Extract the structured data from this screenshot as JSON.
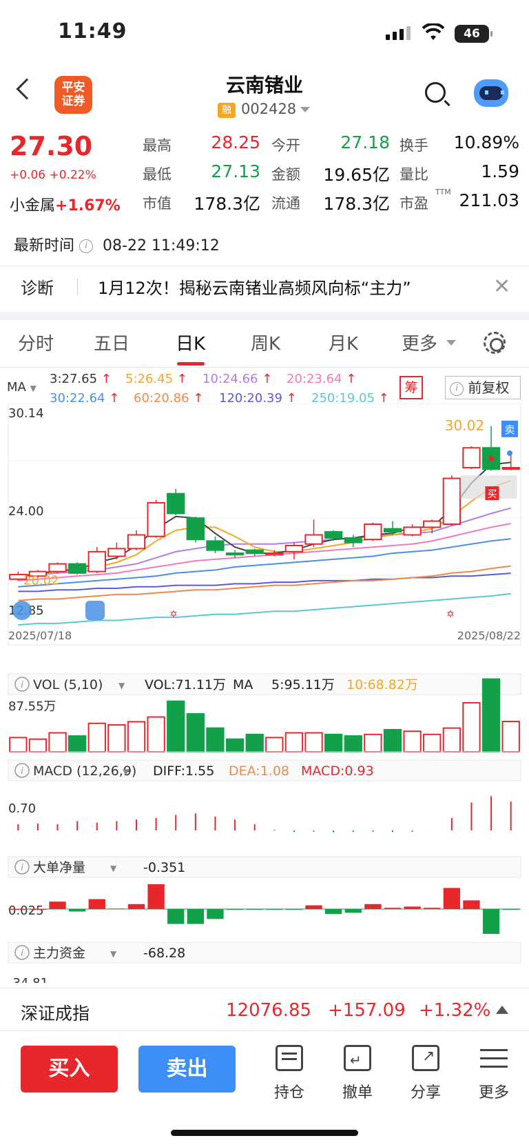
{
  "status_bar": {
    "time": "11:49",
    "battery": "46"
  },
  "header": {
    "logo_text": "平安\n证券",
    "title": "云南锗业",
    "rong_badge": "融",
    "code": "002428"
  },
  "quote": {
    "price": "27.30",
    "change": "+0.06 +0.22%",
    "sector_name": "小金属",
    "sector_change": "+1.67%",
    "fields": [
      {
        "label": "最高",
        "value": "28.25",
        "color": "red"
      },
      {
        "label": "今开",
        "value": "27.18",
        "color": "green"
      },
      {
        "label": "换手",
        "value": "10.89%",
        "color": "black"
      },
      {
        "label": "最低",
        "value": "27.13",
        "color": "green"
      },
      {
        "label": "金额",
        "value": "19.65亿",
        "color": "black"
      },
      {
        "label": "量比",
        "value": "1.59",
        "color": "black"
      },
      {
        "label": "市值",
        "value": "178.3亿",
        "color": "black"
      },
      {
        "label": "流通",
        "value": "178.3亿",
        "color": "black"
      },
      {
        "label": "市盈",
        "value": "211.03",
        "color": "black",
        "sup": "TTM"
      }
    ],
    "update_label": "最新时间",
    "update_time": "08-22 11:49:12"
  },
  "diagnosis": {
    "label": "诊断",
    "text": "1月12次！揭秘云南锗业高频风向标“主力”"
  },
  "tabs": [
    "分时",
    "五日",
    "日K",
    "周K",
    "月K",
    "更多"
  ],
  "active_tab": "日K",
  "ma_legend": {
    "label": "MA",
    "row1": [
      {
        "text": "3:27.65",
        "color": "#333333"
      },
      {
        "text": "5:26.45",
        "color": "#f5a623"
      },
      {
        "text": "10:24.66",
        "color": "#b57be0"
      },
      {
        "text": "20:23.64",
        "color": "#f07ab8"
      }
    ],
    "row2": [
      {
        "text": "30:22.64",
        "color": "#4a90e2"
      },
      {
        "text": "60:20.86",
        "color": "#f08a4b"
      },
      {
        "text": "120:20.39",
        "color": "#5b5bd6"
      },
      {
        "text": "250:19.05",
        "color": "#5bc8d0"
      }
    ],
    "chou": "筹",
    "fuquan": "前复权"
  },
  "chart_data": {
    "type": "candlestick",
    "y_top_label": "30.14",
    "y_mid_label": "24.00",
    "y_bottom_label": "12.85",
    "start_label": "20.02",
    "max_marker": "30.02",
    "sell_tag": "卖",
    "buy_tag": "买",
    "x_start": "2025/07/18",
    "x_end": "2025/08/22",
    "candles": [
      {
        "o": 20.0,
        "c": 20.3,
        "h": 20.5,
        "l": 19.9
      },
      {
        "o": 20.2,
        "c": 20.5,
        "h": 20.6,
        "l": 20.0
      },
      {
        "o": 20.5,
        "c": 21.0,
        "h": 21.1,
        "l": 20.4
      },
      {
        "o": 21.0,
        "c": 20.4,
        "h": 21.1,
        "l": 20.3
      },
      {
        "o": 20.5,
        "c": 21.8,
        "h": 22.1,
        "l": 20.4
      },
      {
        "o": 21.5,
        "c": 22.0,
        "h": 22.4,
        "l": 21.3
      },
      {
        "o": 22.0,
        "c": 22.9,
        "h": 23.2,
        "l": 21.9
      },
      {
        "o": 22.8,
        "c": 25.0,
        "h": 25.2,
        "l": 22.7
      },
      {
        "o": 25.6,
        "c": 24.3,
        "h": 25.9,
        "l": 24.2
      },
      {
        "o": 24.0,
        "c": 22.6,
        "h": 24.1,
        "l": 22.4
      },
      {
        "o": 22.5,
        "c": 21.9,
        "h": 22.8,
        "l": 21.7
      },
      {
        "o": 21.7,
        "c": 21.6,
        "h": 21.9,
        "l": 21.4
      },
      {
        "o": 21.9,
        "c": 21.7,
        "h": 22.0,
        "l": 21.5
      },
      {
        "o": 21.6,
        "c": 21.7,
        "h": 21.9,
        "l": 21.5
      },
      {
        "o": 21.8,
        "c": 22.2,
        "h": 22.4,
        "l": 21.3
      },
      {
        "o": 22.3,
        "c": 22.9,
        "h": 23.9,
        "l": 22.1
      },
      {
        "o": 23.1,
        "c": 22.7,
        "h": 23.2,
        "l": 22.5
      },
      {
        "o": 22.7,
        "c": 22.4,
        "h": 22.9,
        "l": 22.1
      },
      {
        "o": 22.6,
        "c": 23.6,
        "h": 23.7,
        "l": 22.5
      },
      {
        "o": 23.3,
        "c": 23.1,
        "h": 23.8,
        "l": 22.9
      },
      {
        "o": 22.9,
        "c": 23.4,
        "h": 23.6,
        "l": 22.8
      },
      {
        "o": 23.4,
        "c": 23.8,
        "h": 23.9,
        "l": 23.0
      },
      {
        "o": 23.6,
        "c": 26.6,
        "h": 26.8,
        "l": 23.5
      },
      {
        "o": 27.3,
        "c": 28.6,
        "h": 28.7,
        "l": 27.2
      },
      {
        "o": 28.6,
        "c": 27.2,
        "h": 30.02,
        "l": 27.1
      },
      {
        "o": 27.24,
        "c": 27.3,
        "h": 28.25,
        "l": 27.13
      }
    ],
    "ma3": [
      20.2,
      20.3,
      20.6,
      20.6,
      21.1,
      21.4,
      22.2,
      23.3,
      24.1,
      24.0,
      23.0,
      22.1,
      21.7,
      21.7,
      21.9,
      22.3,
      22.6,
      22.7,
      22.9,
      23.0,
      23.4,
      23.4,
      24.6,
      26.3,
      27.5,
      27.65
    ],
    "ma5": [
      20.3,
      20.3,
      20.5,
      20.6,
      20.8,
      21.1,
      21.6,
      22.5,
      23.2,
      23.4,
      23.4,
      22.8,
      22.1,
      21.8,
      21.8,
      22.0,
      22.2,
      22.4,
      22.7,
      22.9,
      23.1,
      23.3,
      24.1,
      25.1,
      26.0,
      26.45
    ],
    "ma10": [
      20.2,
      20.3,
      20.4,
      20.5,
      20.6,
      20.8,
      21.0,
      21.4,
      21.8,
      22.0,
      22.2,
      22.3,
      22.3,
      22.3,
      22.4,
      22.5,
      22.6,
      22.7,
      22.8,
      22.9,
      23.0,
      23.1,
      23.5,
      23.9,
      24.3,
      24.66
    ],
    "ma20": [
      19.9,
      20.0,
      20.1,
      20.2,
      20.3,
      20.4,
      20.6,
      20.8,
      21.0,
      21.2,
      21.3,
      21.4,
      21.5,
      21.6,
      21.7,
      21.8,
      21.9,
      22.0,
      22.1,
      22.2,
      22.3,
      22.5,
      22.8,
      23.1,
      23.4,
      23.64
    ],
    "ma30": [
      19.5,
      19.6,
      19.7,
      19.8,
      19.9,
      20.0,
      20.1,
      20.2,
      20.4,
      20.5,
      20.6,
      20.8,
      20.9,
      21.0,
      21.1,
      21.2,
      21.3,
      21.4,
      21.5,
      21.7,
      21.8,
      21.9,
      22.1,
      22.3,
      22.5,
      22.64
    ],
    "ma60": [
      18.6,
      18.7,
      18.7,
      18.8,
      18.9,
      19.0,
      19.0,
      19.1,
      19.2,
      19.3,
      19.3,
      19.4,
      19.5,
      19.6,
      19.6,
      19.7,
      19.8,
      19.9,
      19.9,
      20.0,
      20.1,
      20.2,
      20.4,
      20.5,
      20.7,
      20.86
    ],
    "ma120": [
      19.2,
      19.2,
      19.3,
      19.3,
      19.4,
      19.4,
      19.5,
      19.5,
      19.6,
      19.6,
      19.6,
      19.7,
      19.7,
      19.8,
      19.8,
      19.9,
      19.9,
      19.9,
      20.0,
      20.0,
      20.1,
      20.1,
      20.2,
      20.2,
      20.3,
      20.39
    ],
    "ma250": [
      17.0,
      17.1,
      17.1,
      17.2,
      17.3,
      17.3,
      17.4,
      17.5,
      17.5,
      17.6,
      17.7,
      17.7,
      17.8,
      17.9,
      17.9,
      18.0,
      18.1,
      18.2,
      18.3,
      18.4,
      18.5,
      18.6,
      18.7,
      18.8,
      18.9,
      19.05
    ],
    "volume": {
      "header": "VOL (5,10)",
      "vol": "VOL:71.11万",
      "ma_label": "MA",
      "ma5": "5:95.11万",
      "ma10": "10:68.82万",
      "ref_label": "87.55万",
      "values": [
        45,
        40,
        60,
        50,
        90,
        85,
        95,
        110,
        160,
        120,
        75,
        40,
        55,
        45,
        60,
        60,
        55,
        50,
        55,
        70,
        65,
        55,
        75,
        155,
        230,
        96
      ]
    },
    "macd": {
      "header": "MACD (12,26,9)",
      "diff": "DIFF:1.55",
      "dea": "DEA:1.08",
      "macd": "MACD:0.93",
      "ref_label": "0.70",
      "hist": [
        0.2,
        0.22,
        0.2,
        0.3,
        0.25,
        0.3,
        0.35,
        0.4,
        0.5,
        0.55,
        0.45,
        0.35,
        0.2,
        0.02,
        -0.05,
        -0.04,
        -0.06,
        -0.05,
        -0.04,
        -0.05,
        -0.04,
        0.0,
        0.4,
        0.9,
        1.1,
        0.93
      ]
    },
    "big_order": {
      "header": "大单净量",
      "value": "-0.351",
      "ref_label": "0.025",
      "values": [
        0,
        0,
        0.3,
        -0.1,
        0.4,
        0.02,
        0.2,
        1.0,
        -0.6,
        -0.6,
        -0.4,
        -0.03,
        -0.03,
        -0.03,
        -0.03,
        0.15,
        -0.2,
        -0.15,
        0.2,
        0.05,
        0.1,
        0.05,
        0.85,
        0.35,
        -1.0,
        -0.03
      ]
    },
    "main_fund": {
      "header": "主力资金",
      "value": "-68.28",
      "ref_label": "-34.81"
    }
  },
  "index_bar": {
    "name": "深证成指",
    "value": "12076.85",
    "change": "+157.09",
    "pct": "+1.32%"
  },
  "footer": {
    "buy": "买入",
    "sell": "卖出",
    "items": [
      "持仓",
      "撤单",
      "分享",
      "更多"
    ]
  }
}
